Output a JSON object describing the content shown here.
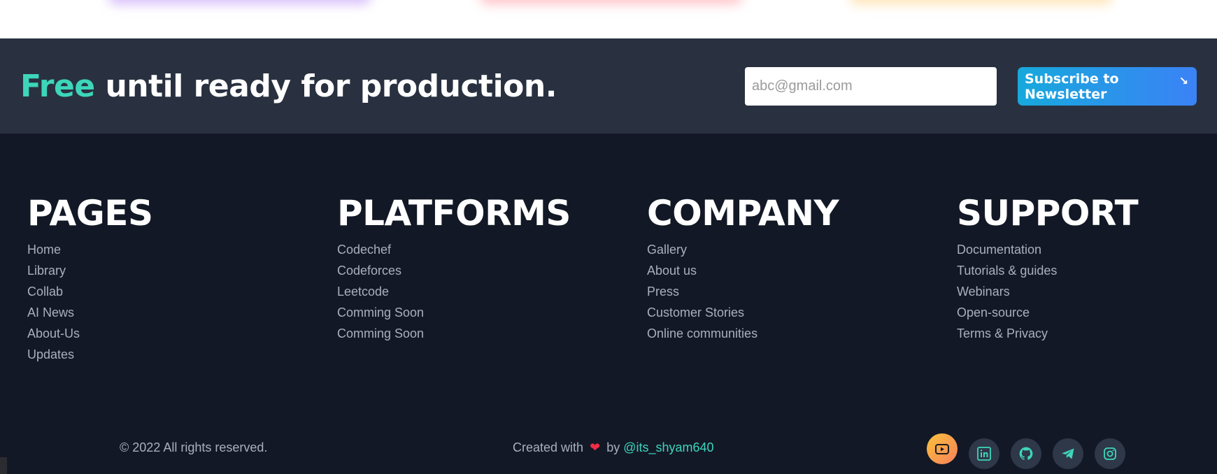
{
  "newsletter": {
    "title_accent": "Free",
    "title_rest": " until ready for production.",
    "email_placeholder": "abc@gmail.com",
    "subscribe_label": "Subscribe to Newsletter",
    "subscribe_arrow": "↘"
  },
  "columns": [
    {
      "heading": "PAGES",
      "links": [
        "Home",
        "Library",
        "Collab",
        "AI News",
        "About-Us",
        "Updates"
      ]
    },
    {
      "heading": "PLATFORMS",
      "links": [
        "Codechef",
        "Codeforces",
        "Leetcode",
        "Comming Soon",
        "Comming Soon"
      ]
    },
    {
      "heading": "COMPANY",
      "links": [
        "Gallery",
        "About us",
        "Press",
        "Customer Stories",
        "Online communities"
      ]
    },
    {
      "heading": "SUPPORT",
      "links": [
        "Documentation",
        "Tutorials & guides",
        "Webinars",
        "Open-source",
        "Terms & Privacy"
      ]
    }
  ],
  "bottom": {
    "copyright": "© 2022 All rights reserved.",
    "created_prefix": "Created with",
    "heart": "❤",
    "created_by": "by",
    "handle": "@its_shyam640"
  },
  "socials": [
    {
      "name": "youtube-icon",
      "active": true
    },
    {
      "name": "linkedin-icon",
      "active": false
    },
    {
      "name": "github-icon",
      "active": false
    },
    {
      "name": "telegram-icon",
      "active": false
    },
    {
      "name": "instagram-icon",
      "active": false
    }
  ],
  "colors": {
    "accent_teal": "#3dd6bb",
    "band_bg": "#293140",
    "footer_bg": "#131826",
    "button_gradient_start": "#17a9dc",
    "button_gradient_end": "#3b82f6",
    "youtube_gradient_start": "#f9c23c",
    "youtube_gradient_end": "#f97f5a"
  }
}
